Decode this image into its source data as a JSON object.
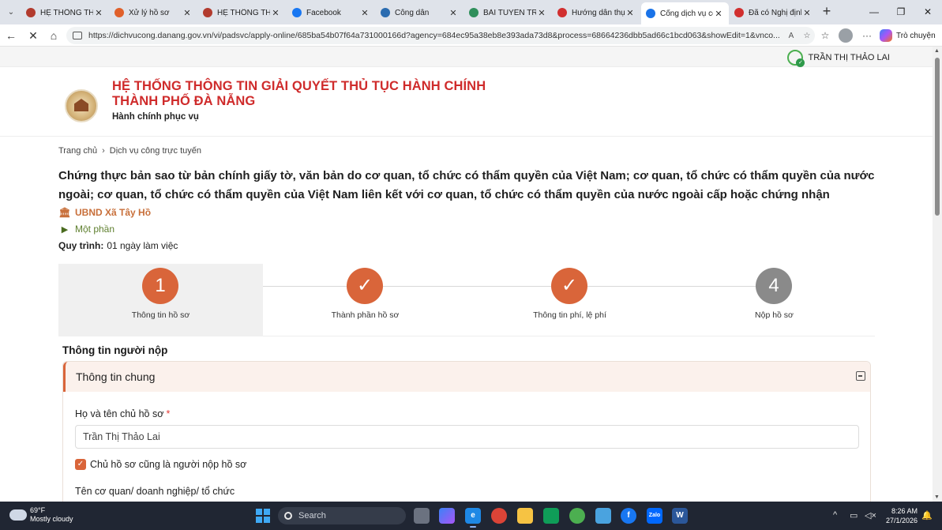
{
  "browser": {
    "tabs": [
      {
        "label": "HỆ THỐNG THÔN",
        "fav_color": "#b23b2e",
        "active": false
      },
      {
        "label": "Xử lý hồ sơ",
        "fav_color": "#e0602a",
        "active": false
      },
      {
        "label": "HỆ THỐNG THÔN",
        "fav_color": "#b23b2e",
        "active": false
      },
      {
        "label": "Facebook",
        "fav_color": "#1877f2",
        "active": false
      },
      {
        "label": "Công dân",
        "fav_color": "#2b6cb0",
        "active": false
      },
      {
        "label": "BÀI TUYÊN TRUYỀ",
        "fav_color": "#2f8f5b",
        "active": false
      },
      {
        "label": "Hướng dẫn thực",
        "fav_color": "#d12f2f",
        "active": false
      },
      {
        "label": "Cổng dịch vụ côn",
        "fav_color": "#1a73e8",
        "active": true
      },
      {
        "label": "Đã có Nghị định",
        "fav_color": "#d12f2f",
        "active": false
      }
    ],
    "url": "https://dichvucong.danang.gov.vn/vi/padsvc/apply-online/685ba54b07f64a731000166d?agency=684ec95a38eb8e393ada73d8&process=68664236dbb5ad66c1bcd063&showEdit=1&vnco...",
    "copilot_label": "Trò chuyện"
  },
  "page": {
    "user_name": "TRẦN THỊ THẢO LAI",
    "site_title_line1": "HỆ THỐNG THÔNG TIN GIẢI QUYẾT THỦ TỤC HÀNH CHÍNH",
    "site_title_line2": "THÀNH PHỐ ĐÀ NẴNG",
    "site_subtitle": "Hành chính phục vụ",
    "breadcrumb": [
      "Trang chủ",
      "Dịch vụ công trực tuyến"
    ],
    "procedure_title": "Chứng thực bản sao từ bản chính giấy tờ, văn bản do cơ quan, tổ chức có thẩm quyền của Việt Nam; cơ quan, tổ chức có thẩm quyền của nước ngoài; cơ quan, tổ chức có thẩm quyền của Việt Nam liên kết với cơ quan, tổ chức có thẩm quyền của nước ngoài cấp hoặc chứng nhận",
    "agency": "UBND Xã Tây Hồ",
    "service_level": "Một phần",
    "process_label": "Quy trình:",
    "process_value": "01 ngày làm việc",
    "steps": [
      {
        "num": "1",
        "label": "Thông tin hồ sơ",
        "state": "current"
      },
      {
        "num": "✓",
        "label": "Thành phần hồ sơ",
        "state": "done"
      },
      {
        "num": "✓",
        "label": "Thông tin phí, lệ phí",
        "state": "done"
      },
      {
        "num": "4",
        "label": "Nộp hồ sơ",
        "state": "todo"
      }
    ],
    "section_heading": "Thông tin người nộp",
    "card_title": "Thông tin chung",
    "owner_label": "Họ và tên chủ hồ sơ",
    "required_mark": "*",
    "owner_value": "Trần Thị Thảo Lai",
    "checkbox_label": "Chủ hồ sơ cũng là người nộp hồ sơ",
    "org_label": "Tên cơ quan/ doanh nghiệp/ tổ chức"
  },
  "taskbar": {
    "temp": "69°F",
    "weather": "Mostly cloudy",
    "search_placeholder": "Search",
    "time": "8:26 AM",
    "date": "27/1/2026"
  },
  "colors": {
    "accent": "#d9653a",
    "title_red": "#cf2b2b",
    "agency": "#c86f3a",
    "level_green": "#5e7f2e"
  }
}
